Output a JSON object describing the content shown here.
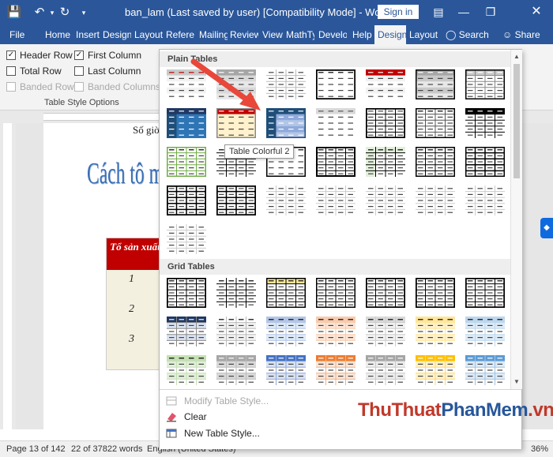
{
  "window": {
    "title": "ban_lam (Last saved by user) [Compatibility Mode]  -  Word",
    "sign_in": "Sign in"
  },
  "tabs": [
    {
      "label": "File",
      "active": false
    },
    {
      "label": "Home",
      "active": false
    },
    {
      "label": "Insert",
      "active": false
    },
    {
      "label": "Design",
      "active": false
    },
    {
      "label": "Layout",
      "active": false
    },
    {
      "label": "Referer",
      "active": false
    },
    {
      "label": "Mailing",
      "active": false
    },
    {
      "label": "Review",
      "active": false
    },
    {
      "label": "View",
      "active": false
    },
    {
      "label": "MathTy",
      "active": false
    },
    {
      "label": "Develop",
      "active": false
    },
    {
      "label": "Help",
      "active": false
    },
    {
      "label": "Design",
      "active": true
    },
    {
      "label": "Layout",
      "active": false
    }
  ],
  "search_label": "Search",
  "share_label": "Share",
  "style_options": {
    "header_row": {
      "label": "Header Row",
      "checked": true,
      "enabled": true
    },
    "first_column": {
      "label": "First Column",
      "checked": true,
      "enabled": true
    },
    "total_row": {
      "label": "Total Row",
      "checked": false,
      "enabled": true
    },
    "last_column": {
      "label": "Last Column",
      "checked": false,
      "enabled": true
    },
    "banded_rows": {
      "label": "Banded Rows",
      "checked": false,
      "enabled": false
    },
    "banded_columns": {
      "label": "Banded Columns",
      "checked": false,
      "enabled": false
    },
    "group_label": "Table Style Options"
  },
  "gallery": {
    "plain_tables_label": "Plain Tables",
    "grid_tables_label": "Grid Tables",
    "tooltip": "Table Colorful 2",
    "selected_style": "Table Colorful 2",
    "menu": {
      "modify": "Modify Table Style...",
      "clear": "Clear",
      "new": "New Table Style..."
    }
  },
  "document": {
    "line1": "Số giờ",
    "heading": "Cách tô m",
    "table_header": "Tổ sản xuất",
    "rows": [
      "1",
      "2",
      "3"
    ]
  },
  "status": {
    "page": "Page 13 of 142",
    "words": "22 of 37822 words",
    "language": "English (United States)",
    "zoom": "36%"
  },
  "watermark": {
    "part1": "ThuThuat",
    "part2": "PhanMem",
    "part3": ".vn"
  }
}
